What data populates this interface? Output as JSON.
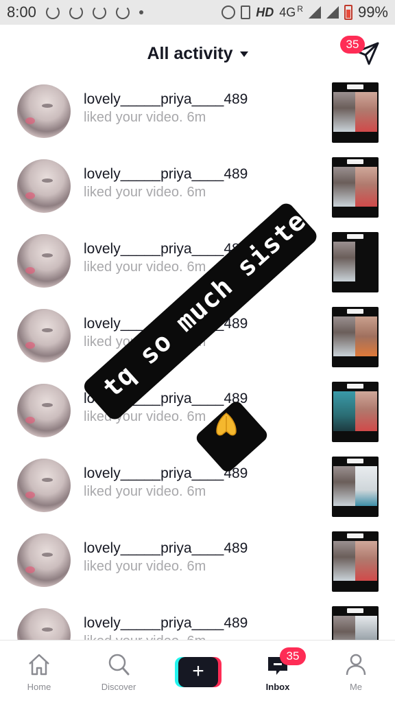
{
  "status_bar": {
    "time": "8:00",
    "network": "HD",
    "network_type": "4G",
    "roaming": "R",
    "battery": "99%"
  },
  "header": {
    "title": "All activity",
    "dm_badge": "35"
  },
  "activity": {
    "items": [
      {
        "username": "lovely_____priya____489",
        "action": "liked your video.",
        "age": "6m",
        "thumb_tag": "duet 4"
      },
      {
        "username": "lovely_____priya____489",
        "action": "liked your video.",
        "age": "6m",
        "thumb_tag": "duet 5"
      },
      {
        "username": "lovely_____priya____489",
        "action": "liked your video.",
        "age": "6m",
        "thumb_tag": "duet 6"
      },
      {
        "username": "lovely_____priya____489",
        "action": "liked your video.",
        "age": "6m",
        "thumb_tag": "duet 7"
      },
      {
        "username": "lovely_____priya____489",
        "action": "liked your video.",
        "age": "6m",
        "thumb_tag": "duet 8"
      },
      {
        "username": "lovely_____priya____489",
        "action": "liked your video.",
        "age": "6m",
        "thumb_tag": "duet 9"
      },
      {
        "username": "lovely_____priya____489",
        "action": "liked your video.",
        "age": "6m",
        "thumb_tag": "duet 10"
      },
      {
        "username": "lovely_____priya____489",
        "action": "liked your video.",
        "age": "6m",
        "thumb_tag": "duet 11"
      }
    ]
  },
  "overlay": {
    "text": "tq so much sister",
    "emoji": "folded-hands-icon"
  },
  "nav": {
    "home": "Home",
    "discover": "Discover",
    "create": "+",
    "inbox": "Inbox",
    "inbox_badge": "35",
    "me": "Me"
  },
  "colors": {
    "accent": "#fe2c55",
    "cyan": "#25f4ee",
    "muted_text": "#a8a8ab"
  }
}
